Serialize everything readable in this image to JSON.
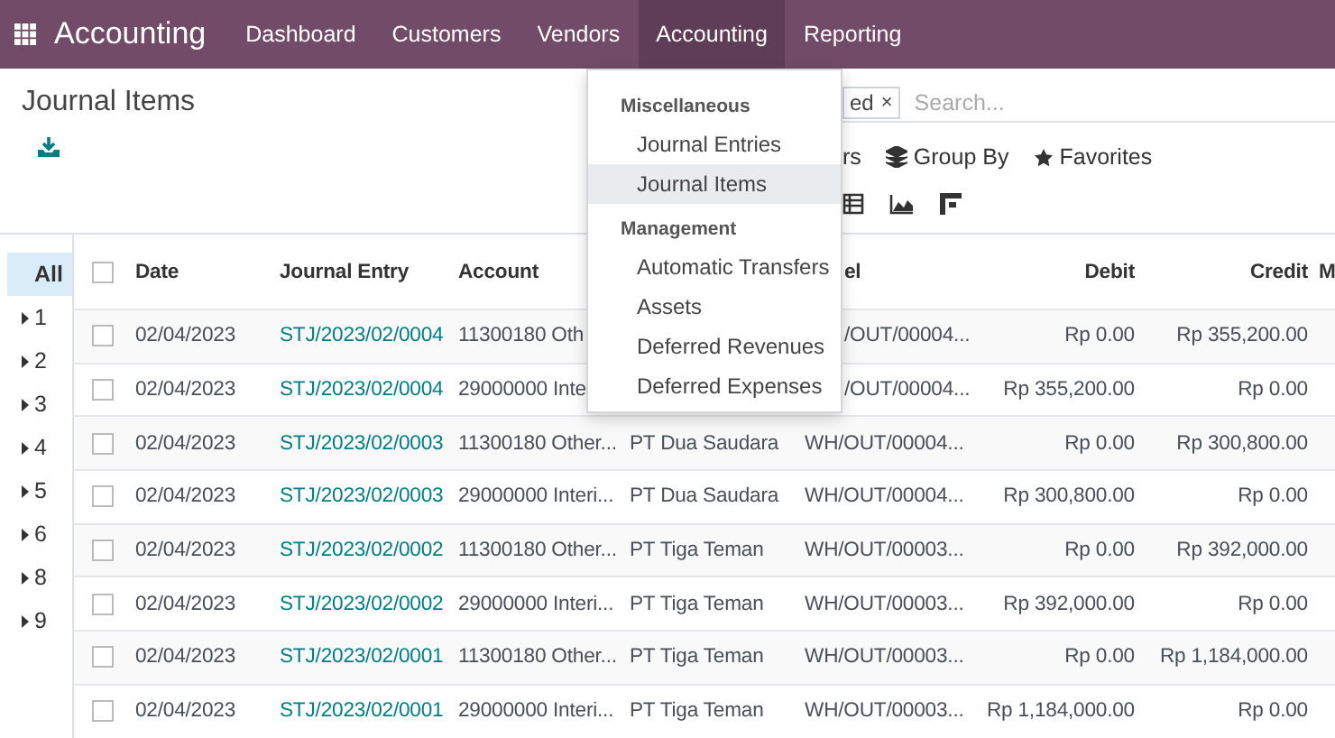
{
  "app_title": "Accounting",
  "nav": [
    {
      "label": "Dashboard",
      "selected": false
    },
    {
      "label": "Customers",
      "selected": false
    },
    {
      "label": "Vendors",
      "selected": false
    },
    {
      "label": "Accounting",
      "selected": true
    },
    {
      "label": "Reporting",
      "selected": false
    }
  ],
  "page_title": "Journal Items",
  "search": {
    "facet": "ed",
    "facet_close": "×",
    "placeholder": "Search..."
  },
  "filter_buttons": [
    {
      "kind": "filters",
      "label": "rs"
    },
    {
      "kind": "groupby",
      "label": "Group By"
    },
    {
      "kind": "favorites",
      "label": "Favorites"
    }
  ],
  "view_switcher": [
    {
      "kind": "list"
    },
    {
      "kind": "graph"
    },
    {
      "kind": "pivot"
    }
  ],
  "menu": {
    "sections": [
      {
        "title": "Miscellaneous",
        "items": [
          {
            "label": "Journal Entries",
            "selected": false
          },
          {
            "label": "Journal Items",
            "selected": true
          }
        ]
      },
      {
        "title": "Management",
        "items": [
          {
            "label": "Automatic Transfers",
            "selected": false
          },
          {
            "label": "Assets",
            "selected": false
          },
          {
            "label": "Deferred Revenues",
            "selected": false
          },
          {
            "label": "Deferred Expenses",
            "selected": false
          }
        ]
      }
    ]
  },
  "sidebar": [
    {
      "label": "All",
      "selected": true,
      "kind": "all"
    },
    {
      "label": "1",
      "selected": false,
      "kind": "group"
    },
    {
      "label": "2",
      "selected": false,
      "kind": "group"
    },
    {
      "label": "3",
      "selected": false,
      "kind": "group"
    },
    {
      "label": "4",
      "selected": false,
      "kind": "group"
    },
    {
      "label": "5",
      "selected": false,
      "kind": "group"
    },
    {
      "label": "6",
      "selected": false,
      "kind": "group"
    },
    {
      "label": "8",
      "selected": false,
      "kind": "group"
    },
    {
      "label": "9",
      "selected": false,
      "kind": "group"
    }
  ],
  "table": {
    "all_checked": false,
    "columns": [
      {
        "label": "Date",
        "kind": "text"
      },
      {
        "label": "Journal Entry",
        "kind": "link"
      },
      {
        "label": "Account",
        "kind": "text"
      },
      {
        "kind": "text"
      },
      {
        "label": "el",
        "kind": "text",
        "cut": true
      },
      {
        "label": "Debit",
        "kind": "amount"
      },
      {
        "label": "Credit",
        "kind": "amount"
      },
      {
        "label": "M",
        "kind": "text"
      }
    ],
    "rows": [
      {
        "checked": false,
        "cells": [
          {
            "text": "02/04/2023"
          },
          {
            "text": "STJ/2023/02/0004"
          },
          {
            "text": "11300180 Oth"
          },
          {},
          {
            "text": "/OUT/00004...",
            "cut": true
          },
          {
            "text": "Rp 0.00"
          },
          {
            "text": "Rp 355,200.00"
          },
          {}
        ]
      },
      {
        "checked": false,
        "cells": [
          {
            "text": "02/04/2023"
          },
          {
            "text": "STJ/2023/02/0004"
          },
          {
            "text": "29000000 Inte"
          },
          {},
          {
            "text": "/OUT/00004...",
            "cut": true
          },
          {
            "text": "Rp 355,200.00"
          },
          {
            "text": "Rp 0.00"
          },
          {}
        ]
      },
      {
        "checked": false,
        "cells": [
          {
            "text": "02/04/2023"
          },
          {
            "text": "STJ/2023/02/0003"
          },
          {
            "text": "11300180 Other..."
          },
          {
            "text": "PT Dua Saudara"
          },
          {
            "text": "WH/OUT/00004..."
          },
          {
            "text": "Rp 0.00"
          },
          {
            "text": "Rp 300,800.00"
          },
          {}
        ]
      },
      {
        "checked": false,
        "cells": [
          {
            "text": "02/04/2023"
          },
          {
            "text": "STJ/2023/02/0003"
          },
          {
            "text": "29000000 Interi..."
          },
          {
            "text": "PT Dua Saudara"
          },
          {
            "text": "WH/OUT/00004..."
          },
          {
            "text": "Rp 300,800.00"
          },
          {
            "text": "Rp 0.00"
          },
          {}
        ]
      },
      {
        "checked": false,
        "cells": [
          {
            "text": "02/04/2023"
          },
          {
            "text": "STJ/2023/02/0002"
          },
          {
            "text": "11300180 Other..."
          },
          {
            "text": "PT Tiga Teman"
          },
          {
            "text": "WH/OUT/00003..."
          },
          {
            "text": "Rp 0.00"
          },
          {
            "text": "Rp 392,000.00"
          },
          {}
        ]
      },
      {
        "checked": false,
        "cells": [
          {
            "text": "02/04/2023"
          },
          {
            "text": "STJ/2023/02/0002"
          },
          {
            "text": "29000000 Interi..."
          },
          {
            "text": "PT Tiga Teman"
          },
          {
            "text": "WH/OUT/00003..."
          },
          {
            "text": "Rp 392,000.00"
          },
          {
            "text": "Rp 0.00"
          },
          {}
        ]
      },
      {
        "checked": false,
        "cells": [
          {
            "text": "02/04/2023"
          },
          {
            "text": "STJ/2023/02/0001"
          },
          {
            "text": "11300180 Other..."
          },
          {
            "text": "PT Tiga Teman"
          },
          {
            "text": "WH/OUT/00003..."
          },
          {
            "text": "Rp 0.00"
          },
          {
            "text": "Rp 1,184,000.00"
          },
          {}
        ]
      },
      {
        "checked": false,
        "cells": [
          {
            "text": "02/04/2023"
          },
          {
            "text": "STJ/2023/02/0001"
          },
          {
            "text": "29000000 Interi..."
          },
          {
            "text": "PT Tiga Teman"
          },
          {
            "text": "WH/OUT/00003..."
          },
          {
            "text": "Rp 1,184,000.00"
          },
          {
            "text": "Rp 0.00"
          },
          {}
        ]
      }
    ]
  }
}
